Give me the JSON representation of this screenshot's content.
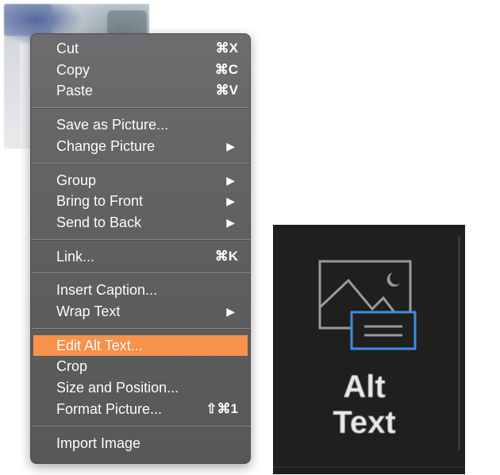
{
  "context_menu": {
    "groups": [
      [
        {
          "label": "Cut",
          "shortcut": "⌘X",
          "submenu": false
        },
        {
          "label": "Copy",
          "shortcut": "⌘C",
          "submenu": false
        },
        {
          "label": "Paste",
          "shortcut": "⌘V",
          "submenu": false
        }
      ],
      [
        {
          "label": "Save as Picture...",
          "shortcut": "",
          "submenu": false
        },
        {
          "label": "Change Picture",
          "shortcut": "",
          "submenu": true
        }
      ],
      [
        {
          "label": "Group",
          "shortcut": "",
          "submenu": true
        },
        {
          "label": "Bring to Front",
          "shortcut": "",
          "submenu": true
        },
        {
          "label": "Send to Back",
          "shortcut": "",
          "submenu": true
        }
      ],
      [
        {
          "label": "Link...",
          "shortcut": "⌘K",
          "submenu": false
        }
      ],
      [
        {
          "label": "Insert Caption...",
          "shortcut": "",
          "submenu": false
        },
        {
          "label": "Wrap Text",
          "shortcut": "",
          "submenu": true
        }
      ],
      [
        {
          "label": "Edit Alt Text...",
          "shortcut": "",
          "submenu": false,
          "highlighted": true
        },
        {
          "label": "Crop",
          "shortcut": "",
          "submenu": false
        },
        {
          "label": "Size and Position...",
          "shortcut": "",
          "submenu": false
        },
        {
          "label": "Format Picture...",
          "shortcut": "⇧⌘1",
          "submenu": false
        }
      ],
      [
        {
          "label": "Import Image",
          "shortcut": "",
          "submenu": false
        }
      ]
    ],
    "submenu_arrow": "▶",
    "highlight_color": "#f6924a"
  },
  "alt_text_button": {
    "label_line1": "Alt",
    "label_line2": "Text",
    "icon": "alt-text-image-icon",
    "accent_color": "#3b8ee0"
  }
}
